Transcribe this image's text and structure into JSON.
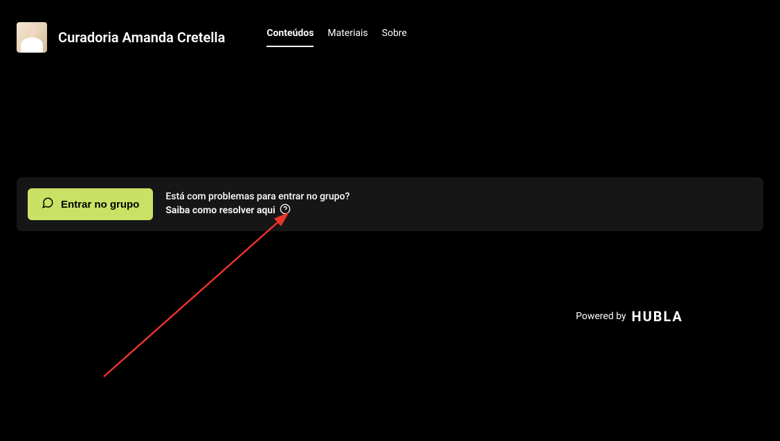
{
  "header": {
    "title": "Curadoria Amanda Cretella",
    "tabs": [
      {
        "label": "Conteúdos",
        "active": true
      },
      {
        "label": "Materiais",
        "active": false
      },
      {
        "label": "Sobre",
        "active": false
      }
    ]
  },
  "actionBar": {
    "joinButtonLabel": "Entrar no grupo",
    "helpQuestion": "Está com problemas para entrar no grupo?",
    "helpLink": "Saiba como resolver aqui"
  },
  "footer": {
    "poweredByText": "Powered by",
    "brandName": "HUBLA"
  }
}
